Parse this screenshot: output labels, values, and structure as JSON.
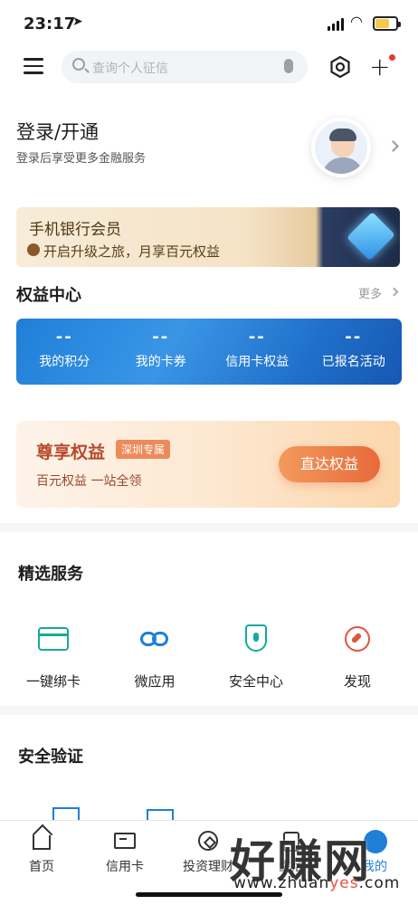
{
  "status_bar": {
    "time": "23:17"
  },
  "search": {
    "placeholder": "查询个人征信"
  },
  "login": {
    "title": "登录/开通",
    "subtitle": "登录后享受更多金融服务"
  },
  "member_banner": {
    "title": "手机银行会员",
    "subtitle": "开启升级之旅，月享百元权益"
  },
  "rights_center": {
    "title": "权益中心",
    "more_label": "更多",
    "items": [
      {
        "value": "--",
        "label": "我的积分"
      },
      {
        "value": "--",
        "label": "我的卡券"
      },
      {
        "value": "--",
        "label": "信用卡权益"
      },
      {
        "value": "--",
        "label": "已报名活动"
      }
    ]
  },
  "exclusive_banner": {
    "title": "尊享权益",
    "tag": "深圳专属",
    "subtitle": "百元权益 一站全领",
    "button": "直达权益"
  },
  "featured_services": {
    "title": "精选服务",
    "items": [
      {
        "label": "一键绑卡",
        "icon": "card-bind-icon"
      },
      {
        "label": "微应用",
        "icon": "link-icon"
      },
      {
        "label": "安全中心",
        "icon": "shield-icon"
      },
      {
        "label": "发现",
        "icon": "compass-icon"
      }
    ]
  },
  "security_verification": {
    "title": "安全验证"
  },
  "tab_bar": {
    "items": [
      {
        "label": "首页",
        "icon": "home-icon"
      },
      {
        "label": "信用卡",
        "icon": "credit-card-icon"
      },
      {
        "label": "投资理财",
        "icon": "coin-icon"
      },
      {
        "label": "生活",
        "icon": "life-icon"
      },
      {
        "label": "我的",
        "icon": "me-icon"
      }
    ]
  },
  "watermark": {
    "text": "好赚网",
    "url_prefix": "www.zhuan",
    "url_highlight": "yes",
    "url_suffix": ".com"
  },
  "colors": {
    "primary_blue": "#1e7fd8",
    "teal": "#18a99a",
    "accent_orange": "#e86a3a",
    "red": "#e25341"
  }
}
